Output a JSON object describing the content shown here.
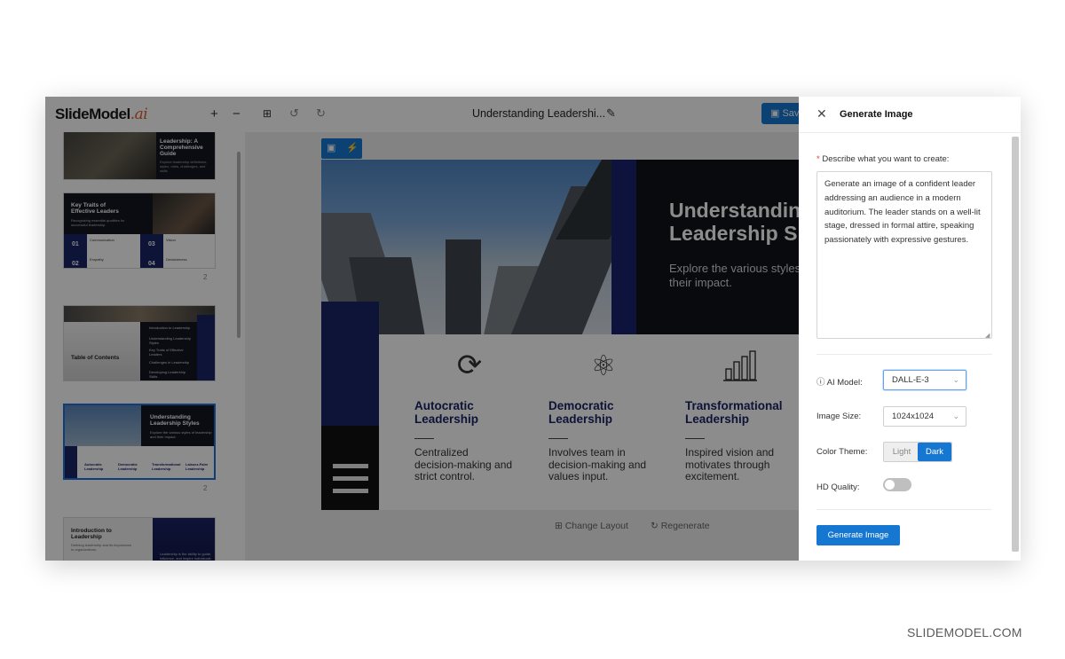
{
  "app": {
    "logo_text": "SlideModel",
    "logo_suffix": ".ai",
    "doc_title": "Understanding Leadershi...",
    "save_label": "Sav",
    "icons": [
      "plus-icon",
      "minus-icon",
      "grid-icon",
      "undo-icon",
      "redo-icon",
      "edit-icon",
      "save-icon"
    ]
  },
  "thumbnails": [
    {
      "title": "Leadership: A Comprehensive Guide",
      "subtitle": "Explore leadership definitions, styles, roles, challenges, and skills."
    },
    {
      "title": "Key Traits of Effective Leaders",
      "subtitle": "Recognizing essential qualities for successful leadership.",
      "nums": [
        "01",
        "02",
        "03",
        "04"
      ],
      "labels": [
        "Communication",
        "Empathy",
        "Vision",
        "Decisiveness"
      ],
      "page": "2"
    },
    {
      "title": "Table of Contents",
      "items": [
        "Introduction to Leadership",
        "Understanding Leadership Styles",
        "Key Traits of Effective Leaders",
        "Challenges in Leadership",
        "Developing Leadership Skills"
      ]
    },
    {
      "title": "Understanding Leadership Styles",
      "subtitle": "Explore the various styles of leadership and their impact.",
      "cols": [
        "Autocratic Leadership",
        "Democratic Leadership",
        "Transformational Leadership",
        "Laissez-Faire Leadership"
      ],
      "page": "2"
    },
    {
      "title": "Introduction to Leadership",
      "subtitle": "Defining leadership and its importance in organizations.",
      "body": "Leadership is the ability to guide, influence, and inspire individuals or groups towards achieving a common"
    }
  ],
  "slide": {
    "title": "Understanding Leadership Styles",
    "title_visible": [
      "Understandin",
      "Leadership S"
    ],
    "subtitle_visible": [
      "Explore the various styles",
      "their impact."
    ],
    "features": [
      {
        "title": "Autocratic Leadership",
        "t1": "Autocratic",
        "t2": "Leadership",
        "d1": "Centralized",
        "d2": "decision-making and",
        "d3": "strict control.",
        "icon": "cycle-arrows-icon"
      },
      {
        "title": "Democratic Leadership",
        "t1": "Democratic",
        "t2": "Leadership",
        "d1": "Involves team in",
        "d2": "decision-making and",
        "d3": "values input.",
        "icon": "atom-icon"
      },
      {
        "title": "Transformational Leadership",
        "t1": "Transformational",
        "t2": "Leadership",
        "d1": "Inspired vision and",
        "d2": "motivates through",
        "d3": "excitement.",
        "icon": "bar-chart-icon"
      }
    ]
  },
  "canvas_actions": {
    "change_layout": "Change Layout",
    "regenerate": "Regenerate"
  },
  "panel": {
    "title": "Generate Image",
    "prompt_label": "Describe what you want to create:",
    "prompt_value": "Generate an image of a confident leader addressing an  audience in a modern auditorium. The leader stands on a well-lit stage, dressed in formal attire, speaking passionately with expressive gestures.",
    "model_label": "AI Model:",
    "model_value": "DALL-E-3",
    "size_label": "Image Size:",
    "size_value": "1024x1024",
    "theme_label": "Color Theme:",
    "theme_options": [
      "Light",
      "Dark"
    ],
    "theme_selected": "Dark",
    "hd_label": "HD Quality:",
    "hd_enabled": false,
    "button_label": "Generate Image"
  },
  "colors": {
    "accent": "#1677d2",
    "navy": "#1a2366",
    "dark": "#111318"
  },
  "watermark": "SLIDEMODEL.COM"
}
